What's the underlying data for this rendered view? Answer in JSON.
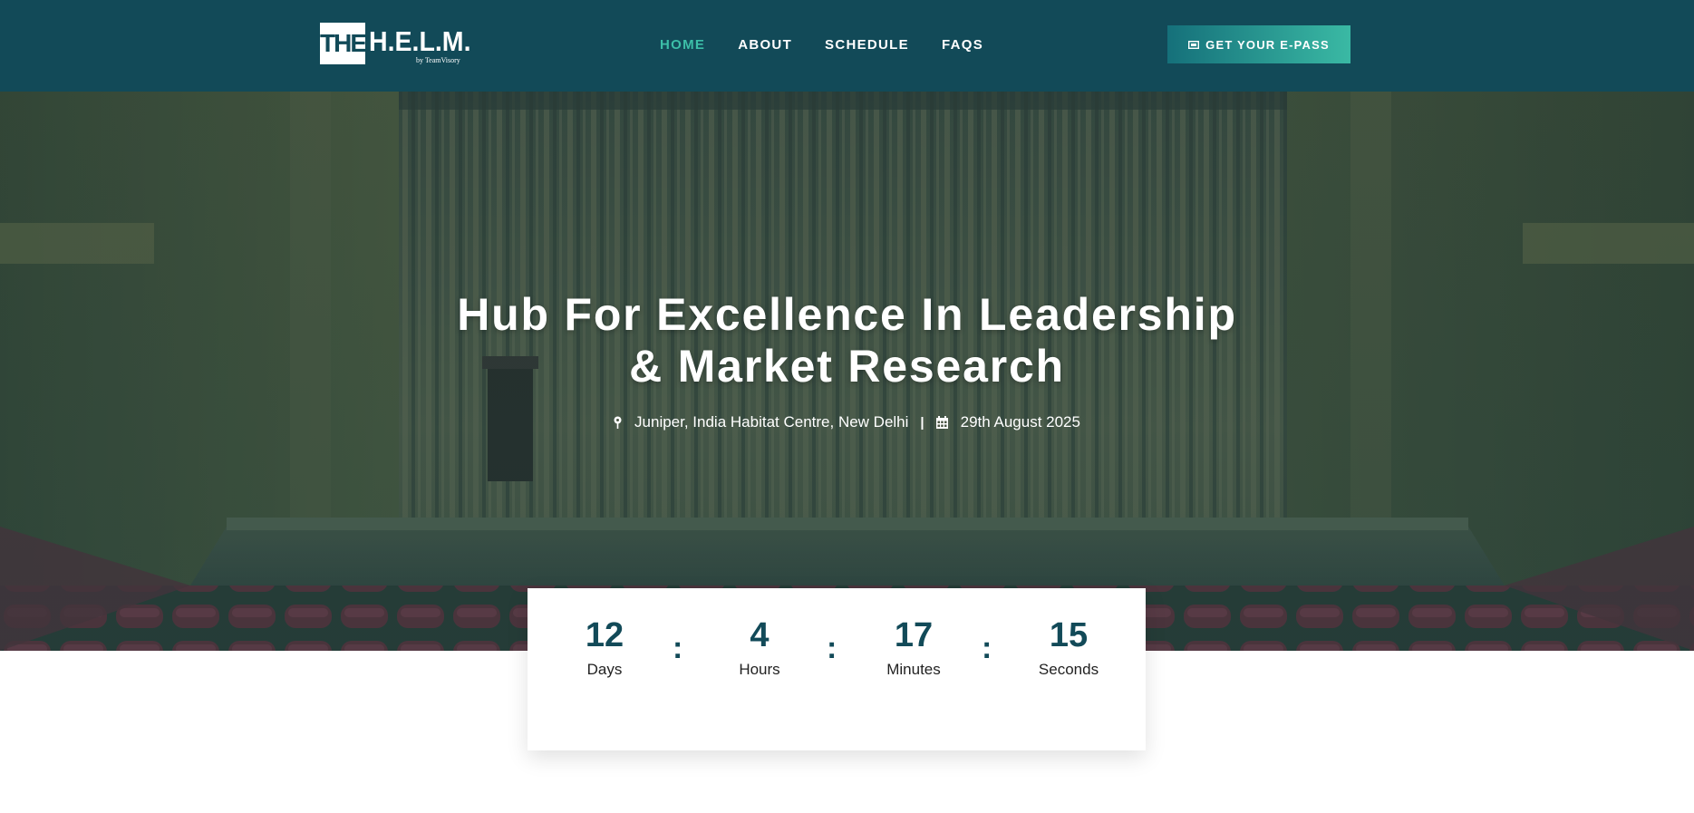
{
  "logo": {
    "box_text": "THE",
    "main_text": "H.E.L.M.",
    "sub_text": "by TeamVisory"
  },
  "nav": {
    "items": [
      {
        "label": "HOME",
        "active": true
      },
      {
        "label": "ABOUT",
        "active": false
      },
      {
        "label": "SCHEDULE",
        "active": false
      },
      {
        "label": "FAQS",
        "active": false
      }
    ],
    "cta_label": "GET YOUR E-PASS",
    "cta_icon": "ticket-icon"
  },
  "hero": {
    "title_line1": "Hub For Excellence In Leadership",
    "title_line2": "& Market Research",
    "location": "Juniper, India Habitat Centre, New Delhi",
    "separator": "|",
    "date": "29th August 2025",
    "location_icon": "map-pin-icon",
    "date_icon": "calendar-icon"
  },
  "countdown": {
    "separator": ":",
    "units": [
      {
        "value": "12",
        "label": "Days"
      },
      {
        "value": "4",
        "label": "Hours"
      },
      {
        "value": "17",
        "label": "Minutes"
      },
      {
        "value": "15",
        "label": "Seconds"
      }
    ]
  },
  "colors": {
    "nav_bg": "#124a58",
    "accent": "#3cbfa8",
    "cta_gradient_start": "#15707a",
    "cta_gradient_end": "#3ab9a4",
    "countdown_number": "#124a58"
  }
}
